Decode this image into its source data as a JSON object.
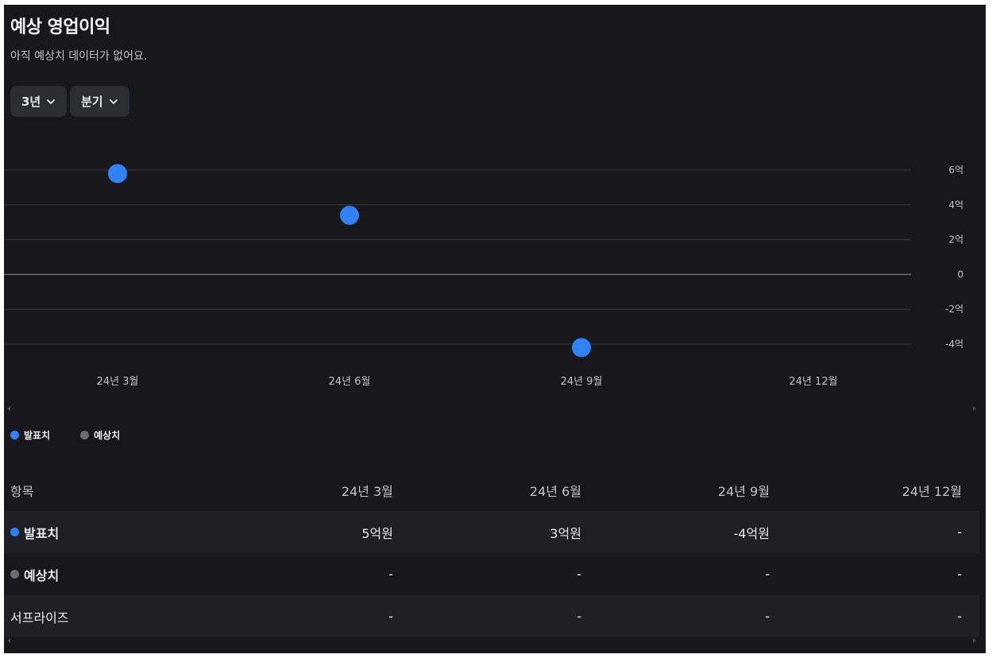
{
  "title": "예상 영업이익",
  "subtitle": "아직 예상치 데이터가 없어요.",
  "controls": {
    "period": "3년",
    "interval": "분기"
  },
  "colors": {
    "reported": "#3182f6",
    "estimate": "#6b6b73",
    "background": "#17171c"
  },
  "chart_data": {
    "type": "scatter",
    "categories": [
      "24년 3월",
      "24년 6월",
      "24년 9월",
      "24년 12월"
    ],
    "series": [
      {
        "name": "발표치",
        "values": [
          5.8,
          3.4,
          -4.2,
          null
        ]
      },
      {
        "name": "예상치",
        "values": [
          null,
          null,
          null,
          null
        ]
      }
    ],
    "y_ticks": [
      "6억",
      "4억",
      "2억",
      "0",
      "-2억",
      "-4억"
    ],
    "ylim": [
      -4,
      6
    ],
    "y_unit": "억",
    "grid": true,
    "legend_position": "bottom-left"
  },
  "legend": [
    {
      "label": "발표치",
      "color": "#3182f6"
    },
    {
      "label": "예상치",
      "color": "#6b6b73"
    }
  ],
  "table": {
    "header": {
      "label": "항목",
      "cols": [
        "24년 3월",
        "24년 6월",
        "24년 9월",
        "24년 12월"
      ]
    },
    "rows": [
      {
        "label": "발표치",
        "values": [
          "5억원",
          "3억원",
          "-4억원",
          "-"
        ]
      },
      {
        "label": "예상치",
        "values": [
          "-",
          "-",
          "-",
          "-"
        ]
      },
      {
        "label": "서프라이즈",
        "values": [
          "-",
          "-",
          "-",
          "-"
        ]
      }
    ]
  }
}
